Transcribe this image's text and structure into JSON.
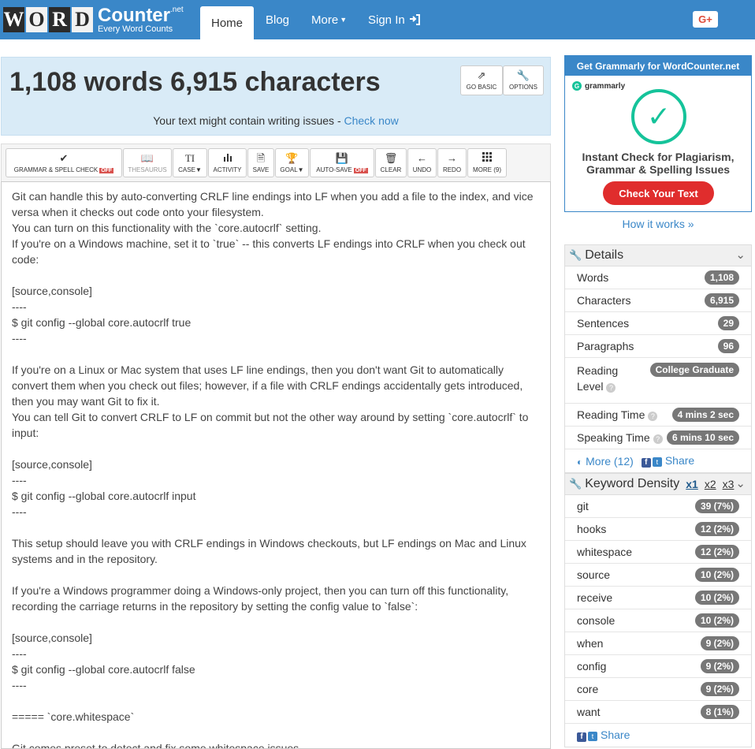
{
  "nav": {
    "logo_letters": [
      "W",
      "O",
      "R",
      "D"
    ],
    "logo_main": "Counter",
    "logo_net": ".net",
    "logo_sub": "Every Word Counts",
    "home": "Home",
    "blog": "Blog",
    "more": "More",
    "sign_in": "Sign In",
    "gplus": "G+"
  },
  "summary": {
    "title": "1,108 words 6,915 characters",
    "go_basic": "GO BASIC",
    "options": "OPTIONS",
    "issues_text": "Your text might contain writing issues - ",
    "issues_link": "Check now"
  },
  "toolbar": {
    "grammar": "GRAMMAR & SPELL CHECK",
    "grammar_state": "OFF",
    "thesaurus": "THESAURUS",
    "case": "CASE",
    "activity": "ACTIVITY",
    "save": "SAVE",
    "goal": "GOAL",
    "autosave": "AUTO-SAVE",
    "autosave_state": "OFF",
    "clear": "CLEAR",
    "undo": "UNDO",
    "redo": "REDO",
    "more": "MORE (9)"
  },
  "editor": {
    "lines": [
      "Git can handle this by auto-converting CRLF line endings into LF when you add a file to the index, and vice",
      "versa when it checks out code onto your filesystem.",
      "You can turn on this functionality with the `core.autocrlf` setting.",
      "If you're on a Windows machine, set it to `true` -- this converts LF endings into CRLF when you check out",
      "code:",
      "",
      "[source,console]",
      "----",
      "$ git config --global core.autocrlf true",
      "----",
      "",
      "If you're on a Linux or Mac system that uses LF line endings, then you don't want Git to automatically",
      "convert them when you check out files; however, if a file with CRLF endings accidentally gets introduced,",
      "then you may want Git to fix it.",
      "You can tell Git to convert CRLF to LF on commit but not the other way around by setting `core.autocrlf` to",
      "input:",
      "",
      "[source,console]",
      "----",
      "$ git config --global core.autocrlf input",
      "----",
      "",
      "This setup should leave you with CRLF endings in Windows checkouts, but LF endings on Mac and Linux",
      "systems and in the repository.",
      "",
      "If you're a Windows programmer doing a Windows-only project, then you can turn off this functionality,",
      "recording the carriage returns in the repository by setting the config value to `false`:",
      "",
      "[source,console]",
      "----",
      "$ git config --global core.autocrlf false",
      "----",
      "",
      "===== `core.whitespace`",
      "",
      "Git comes preset to detect and fix some whitespace issues."
    ]
  },
  "ad": {
    "top": "Get Grammarly for WordCounter.net",
    "brand": "grammarly",
    "headline1": "Instant Check for Plagiarism,",
    "headline2": "Grammar & Spelling Issues",
    "button": "Check Your Text",
    "how": "How it works »"
  },
  "details": {
    "title": "Details",
    "rows": [
      {
        "label": "Words",
        "value": "1,108"
      },
      {
        "label": "Characters",
        "value": "6,915"
      },
      {
        "label": "Sentences",
        "value": "29"
      },
      {
        "label": "Paragraphs",
        "value": "96"
      }
    ],
    "reading_level_1": "Reading",
    "reading_level_2": "Level",
    "reading_level_value": "College Graduate",
    "reading_time": "Reading Time",
    "reading_time_value": "4 mins 2 sec",
    "speaking_time": "Speaking Time",
    "speaking_time_value": "6 mins 10 sec",
    "more": "More (12)",
    "share": "Share"
  },
  "keyword_density": {
    "title": "Keyword Density",
    "x1": "x1",
    "x2": "x2",
    "x3": "x3",
    "rows": [
      {
        "word": "git",
        "count": "39 (7%)"
      },
      {
        "word": "hooks",
        "count": "12 (2%)"
      },
      {
        "word": "whitespace",
        "count": "12 (2%)"
      },
      {
        "word": "source",
        "count": "10 (2%)"
      },
      {
        "word": "receive",
        "count": "10 (2%)"
      },
      {
        "word": "console",
        "count": "10 (2%)"
      },
      {
        "word": "when",
        "count": "9 (2%)"
      },
      {
        "word": "config",
        "count": "9 (2%)"
      },
      {
        "word": "core",
        "count": "9 (2%)"
      },
      {
        "word": "want",
        "count": "8 (1%)"
      }
    ],
    "share": "Share"
  }
}
